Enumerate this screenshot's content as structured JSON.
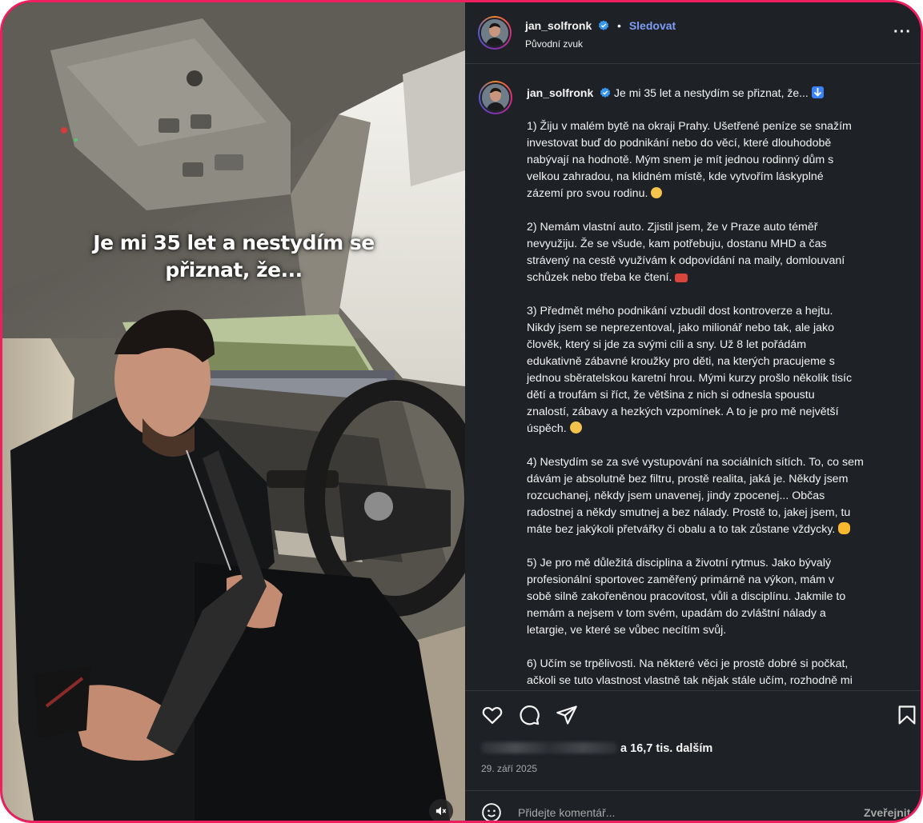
{
  "media": {
    "overlay_line1": "Je mi 35 let a nestydím se",
    "overlay_line2": "přiznat, že...",
    "mute_icon": "speaker-muted-icon"
  },
  "header": {
    "username": "jan_solfronk",
    "separator": "•",
    "follow_label": "Sledovat",
    "audio_label": "Původní zvuk",
    "more_label": "···"
  },
  "caption": {
    "username": "jan_solfronk",
    "first_line": "Je mi 35 let a nestydím se přiznat, že...",
    "p1": "1) Žiju v malém bytě na okraji Prahy. Ušetřené peníze se snažím\ninvestovat buď do podnikání nebo do věcí, které dlouhodobě\nnabývají na hodnotě. Mým snem je mít jednou rodinný dům s\nvelkou zahradou, na klidném místě, kde vytvořím láskyplné\nzázemí pro svou rodinu.",
    "p2": "2) Nemám vlastní auto. Zjistil jsem, že v Praze auto téměř\nnevyužiju. Že se všude, kam potřebuju, dostanu MHD a čas\nstrávený na cestě využívám k odpovídání na maily, domlouvaní\nschůzek nebo třeba ke čtení.",
    "p3": "3) Předmět mého podnikání vzbudil dost kontroverze a hejtu.\nNikdy jsem se neprezentoval, jako milionář nebo tak, ale jako\nčlověk, který si jde za svými cíli a sny. Už 8 let pořádám\nedukativně zábavné kroužky pro děti, na kterých pracujeme s\njednou sběratelskou karetní hrou. Mými kurzy prošlo několik tisíc\ndětí a troufám si říct, že většina z nich si odnesla spoustu\nznalostí, zábavy a hezkých vzpomínek. A to je pro mě největší\núspěch.",
    "p4": "4) Nestydím se za své vystupování na sociálních sítích. To, co sem\ndávám je absolutně bez filtru, prostě realita, jaká je. Někdy jsem\nrozcuchanej, někdy jsem unavenej, jindy zpocenej... Občas\nradostnej a někdy smutnej a bez nálady. Prostě to, jakej jsem, tu\nmáte bez jakýkoli přetvářky či obalu a to tak zůstane vždycky.",
    "p5": "5) Je pro mě důležitá disciplina a životní rytmus. Jako bývalý\nprofesionální sportovec zaměřený primárně na výkon, mám v\nsobě silně zakořeněnou pracovitost, vůli a disciplínu. Jakmile to\nnemám a nejsem v tom svém, upadám do zvláštní nálady a\nletargie, ve které se vůbec necítím svůj.",
    "p6": "6) Učím se trpělivosti. Na některé věci je prostě dobré si počkat,\načkoli se tuto vlastnost vlastně tak nějak stále učím, rozhodně mi"
  },
  "actions": {
    "like_icon": "heart-icon",
    "comment_icon": "comment-icon",
    "share_icon": "send-icon",
    "save_icon": "bookmark-icon"
  },
  "likes": {
    "text": "a 16,7 tis. dalším"
  },
  "date": "29. září 2025",
  "comment": {
    "emoji_icon": "smiley-icon",
    "placeholder": "Přidejte komentář...",
    "publish_label": "Zveřejnit"
  },
  "colors": {
    "frame_border": "#ee1f5e",
    "panel_bg": "#1e2126",
    "follow_blue": "#7f9cf5",
    "verified_blue": "#3897f0"
  }
}
